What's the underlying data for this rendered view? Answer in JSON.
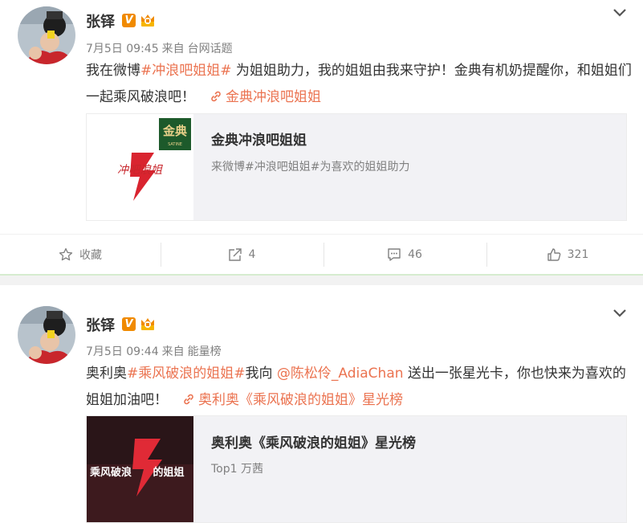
{
  "posts": [
    {
      "username": "张铎",
      "v_badge": "V",
      "time": "7月5日 09:45",
      "via_prefix": "来自",
      "source": "台网话题",
      "text_before": "我在微博",
      "topic": "#冲浪吧姐姐#",
      "text_after": " 为姐姐助力，我的姐姐由我来守护！金典有机奶提醒你，和姐姐们一起乘风破浪吧！",
      "link_text": "金典冲浪吧姐姐",
      "card": {
        "title": "金典冲浪吧姐姐",
        "subtitle": "来微博#冲浪吧姐姐#为喜欢的姐姐助力",
        "logo_text": "金典",
        "logo_sub": "SATINE",
        "image_text": "冲吧浪姐"
      },
      "actions": {
        "favorite": "收藏",
        "repost": "4",
        "comment": "46",
        "like": "321"
      }
    },
    {
      "username": "张铎",
      "v_badge": "V",
      "time": "7月5日 09:44",
      "via_prefix": "来自",
      "source": "能量榜",
      "text_before": "奥利奥",
      "topic": "#乘风破浪的姐姐#",
      "text_mid": "我向 ",
      "mention": "@陈松伶_AdiaChan",
      "text_after": " 送出一张星光卡，你也快来为喜欢的姐姐加油吧！",
      "link_text": "奥利奥《乘风破浪的姐姐》星光榜",
      "card": {
        "title": "奥利奥《乘风破浪的姐姐》星光榜",
        "subtitle": "Top1 万茜",
        "image_text": "乘风破浪",
        "image_text2": "的姐姐"
      }
    }
  ],
  "colors": {
    "accent": "#eb7350",
    "badge": "#f08a00",
    "meta": "#808080",
    "card_bg": "#f2f2f5"
  },
  "icons": {
    "expand": "chevron-down-icon",
    "link": "link-icon",
    "favorite": "star-icon",
    "repost": "share-icon",
    "comment": "comment-icon",
    "like": "thumbs-up-icon"
  }
}
